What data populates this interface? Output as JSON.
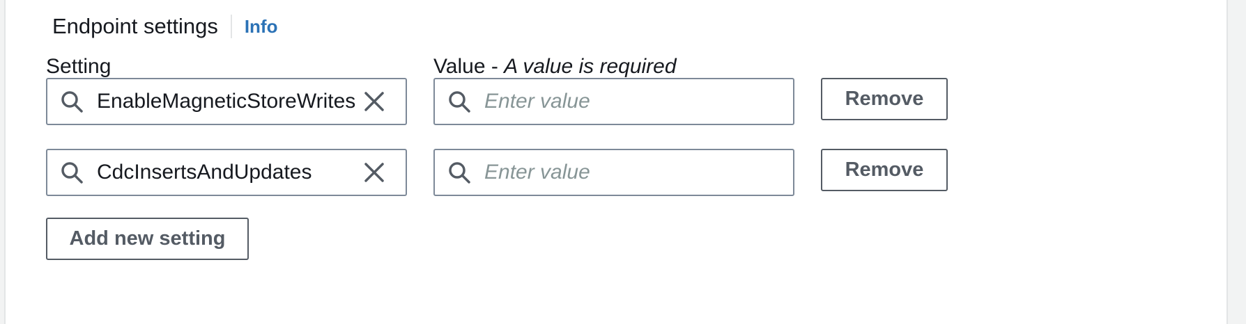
{
  "section": {
    "title": "Endpoint settings",
    "info_link": "Info"
  },
  "columns": {
    "setting_label": "Setting",
    "value_label": "Value - ",
    "value_note": "A value is required"
  },
  "rows": [
    {
      "setting": "EnableMagneticStoreWrites",
      "value": "",
      "value_placeholder": "Enter value",
      "remove_label": "Remove"
    },
    {
      "setting": "CdcInsertsAndUpdates",
      "value": "",
      "value_placeholder": "Enter value",
      "remove_label": "Remove"
    }
  ],
  "add_button_label": "Add new setting",
  "icons": {
    "search": "search-icon",
    "clear": "close-icon"
  },
  "colors": {
    "link": "#2b72b6",
    "text": "#16191f",
    "border": "#7d8998",
    "button_border": "#545b64",
    "placeholder": "#879596"
  }
}
